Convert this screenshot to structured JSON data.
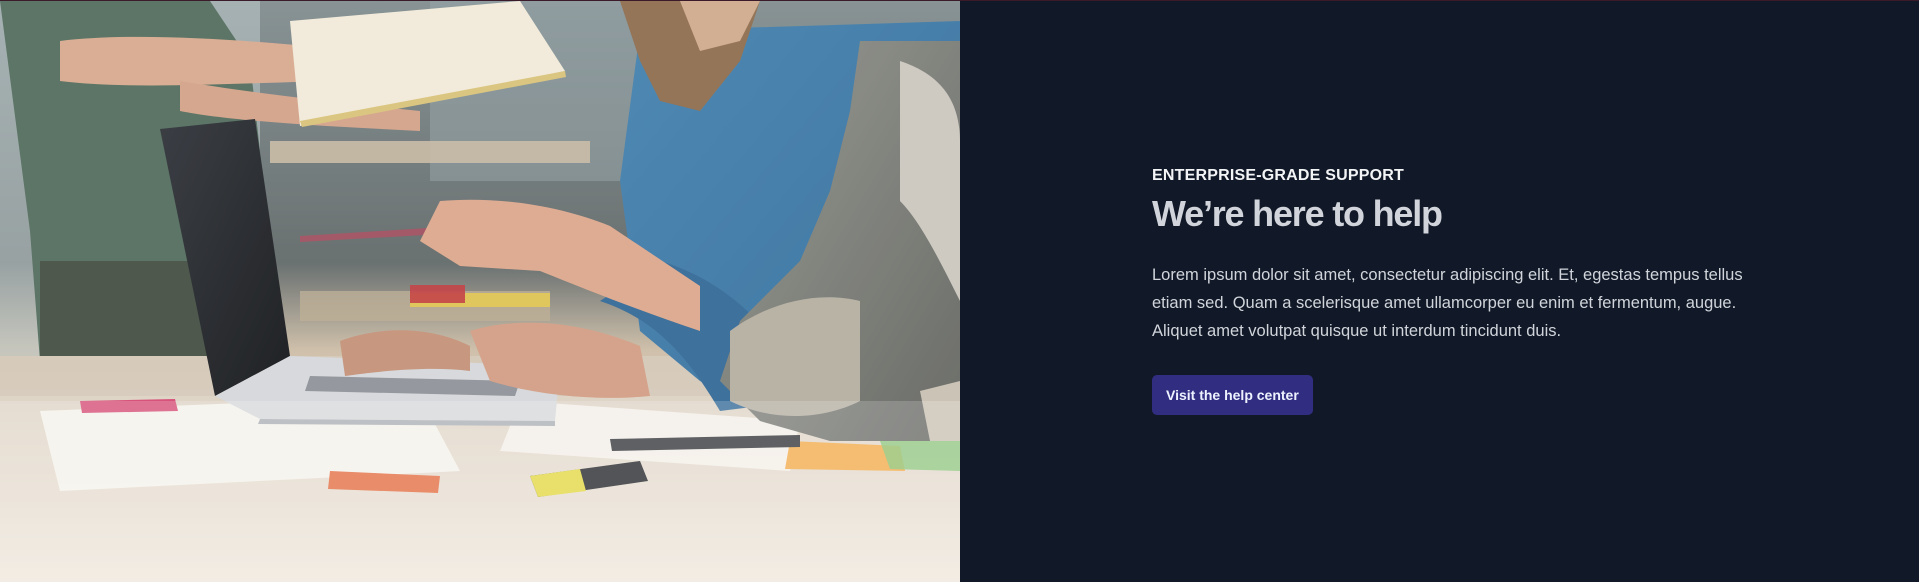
{
  "hero_image": {
    "alt": ""
  },
  "support": {
    "eyebrow": "ENTERPRISE-GRADE SUPPORT",
    "title": "We’re here to help",
    "body": "Lorem ipsum dolor sit amet, consectetur adipiscing elit. Et, egestas tempus tellus etiam sed. Quam a scelerisque amet ullamcorper eu enim et fermentum, augue. Aliquet amet volutpat quisque ut interdum tincidunt duis.",
    "cta_label": "Visit the help center"
  },
  "colors": {
    "background": "#111827",
    "cta_background": "#312e81",
    "cta_text": "#eef2ff",
    "heading": "#d1d5db"
  }
}
